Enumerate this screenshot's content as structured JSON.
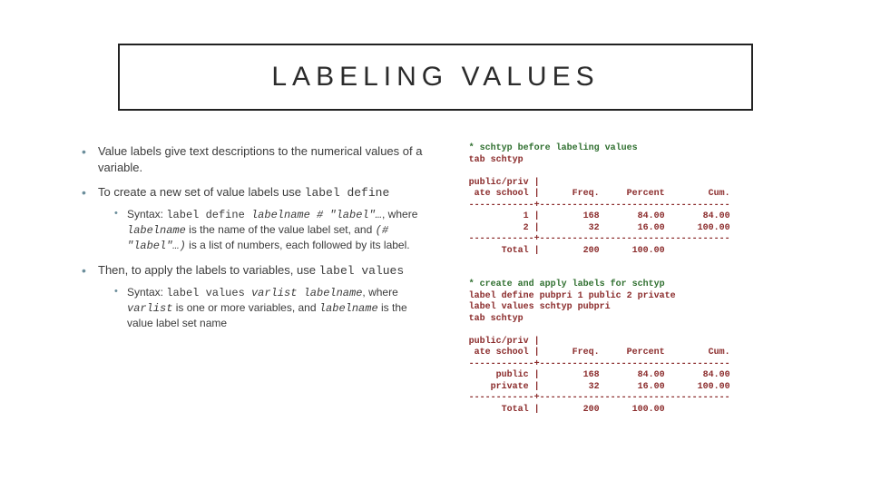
{
  "title": "LABELING VALUES",
  "left": {
    "b1": "Value labels give text descriptions to the numerical values of a variable.",
    "b2_a": "To create a new set of value labels use ",
    "b2_code": "label define",
    "b2_sub_prefix": "Syntax: ",
    "b2_sub_code1": "label define ",
    "b2_sub_code2": "labelname # \"label\"…",
    "b2_sub_mid": ", where ",
    "b2_sub_code3": "labelname",
    "b2_sub_mid2": " is the name of the value label set,  and ",
    "b2_sub_code4": "(# \"label\"…)",
    "b2_sub_end": " is a list of numbers, each followed by its label.",
    "b3_a": "Then, to apply the labels to variables, use ",
    "b3_code": "label values",
    "b3_sub_prefix": "Syntax: ",
    "b3_sub_code1": "label values ",
    "b3_sub_code2": "varlist labelname",
    "b3_sub_mid": ", where ",
    "b3_sub_code3": "varlist",
    "b3_sub_mid2": " is one or more variables, and ",
    "b3_sub_code4": "labelname",
    "b3_sub_end": " is the value label set name"
  },
  "right": {
    "cmt1": "* schtyp before labeling values",
    "cmd1": "tab schtyp",
    "tab1_l1": "public/priv |",
    "tab1_l2": " ate school |      Freq.     Percent        Cum.",
    "tab1_l3": "------------+-----------------------------------",
    "tab1_l4": "          1 |        168       84.00       84.00",
    "tab1_l5": "          2 |         32       16.00      100.00",
    "tab1_l6": "------------+-----------------------------------",
    "tab1_l7": "      Total |        200      100.00",
    "cmt2": "* create and apply labels for schtyp",
    "cmd2": "label define pubpri 1 public 2 private",
    "cmd3": "label values schtyp pubpri",
    "cmd4": "tab schtyp",
    "tab2_l1": "public/priv |",
    "tab2_l2": " ate school |      Freq.     Percent        Cum.",
    "tab2_l3": "------------+-----------------------------------",
    "tab2_l4": "     public |        168       84.00       84.00",
    "tab2_l5": "    private |         32       16.00      100.00",
    "tab2_l6": "------------+-----------------------------------",
    "tab2_l7": "      Total |        200      100.00"
  },
  "chart_data": [
    {
      "type": "table",
      "title": "tab schtyp (before labeling)",
      "columns": [
        "public/private school",
        "Freq.",
        "Percent",
        "Cum."
      ],
      "rows": [
        [
          "1",
          168,
          84.0,
          84.0
        ],
        [
          "2",
          32,
          16.0,
          100.0
        ]
      ],
      "total": [
        "Total",
        200,
        100.0,
        null
      ]
    },
    {
      "type": "table",
      "title": "tab schtyp (after labeling)",
      "columns": [
        "public/private school",
        "Freq.",
        "Percent",
        "Cum."
      ],
      "rows": [
        [
          "public",
          168,
          84.0,
          84.0
        ],
        [
          "private",
          32,
          16.0,
          100.0
        ]
      ],
      "total": [
        "Total",
        200,
        100.0,
        null
      ]
    }
  ]
}
